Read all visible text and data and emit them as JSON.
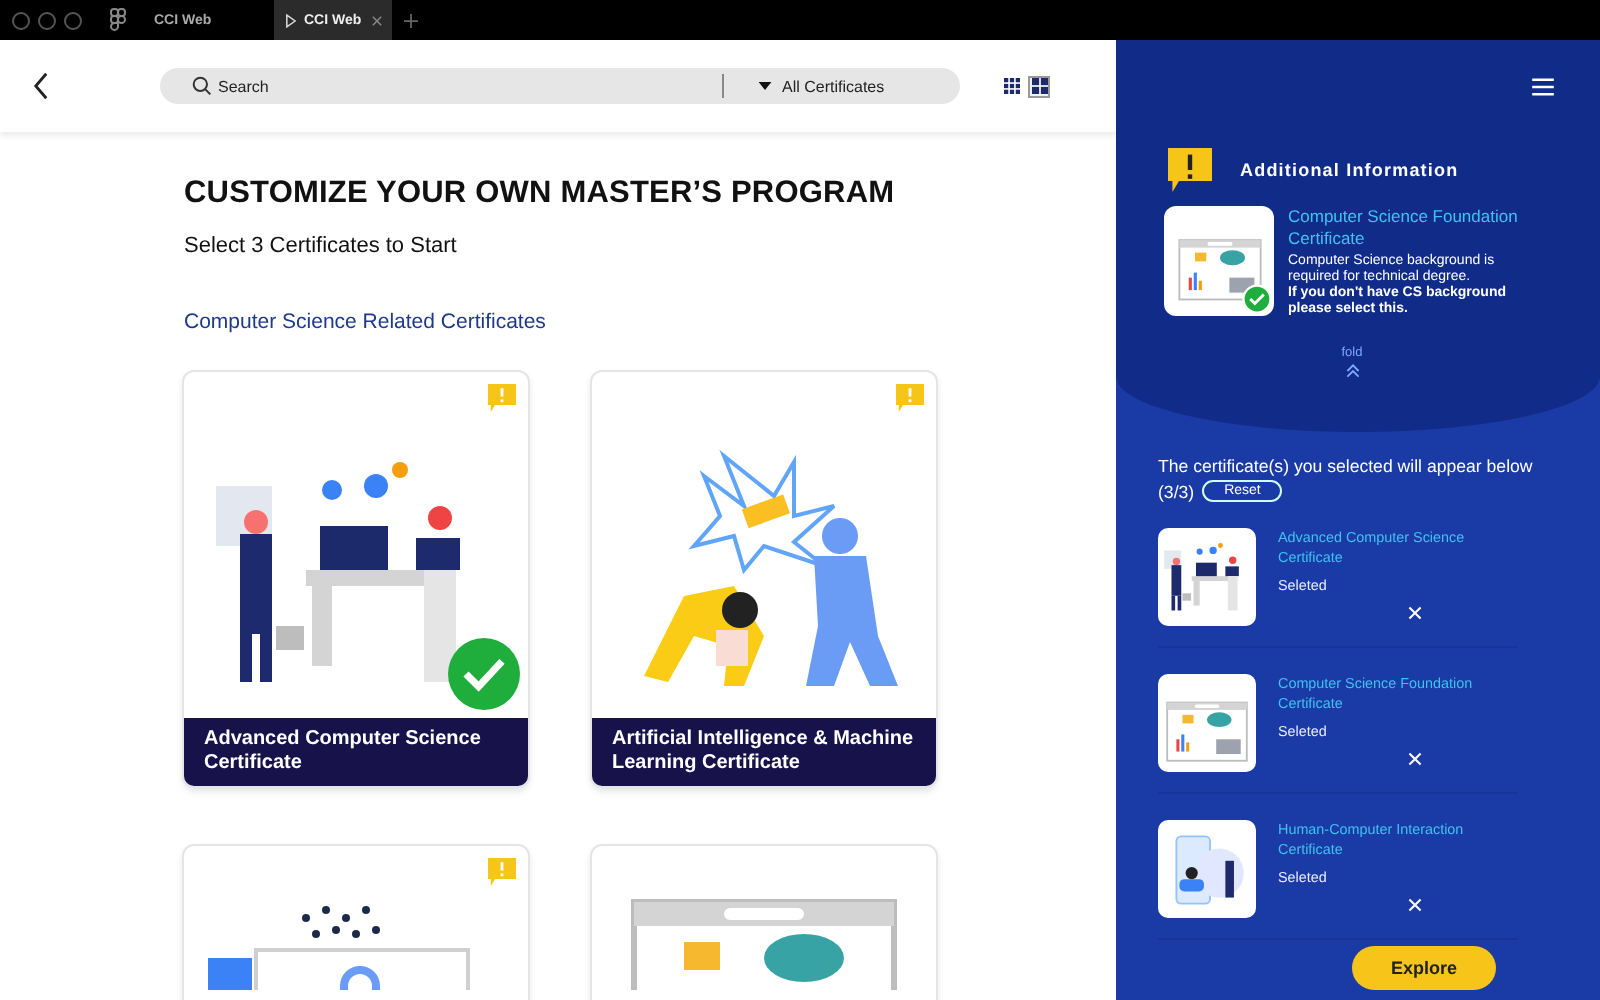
{
  "browser": {
    "tabs": [
      {
        "label": "CCI Web",
        "selected": false,
        "play": false
      },
      {
        "label": "CCI Web",
        "selected": true,
        "play": true
      }
    ]
  },
  "header": {
    "search": {
      "placeholder": "Search"
    },
    "filter": {
      "value": "All Certificates"
    },
    "views": [
      {
        "kind": "small-grid",
        "selected": false
      },
      {
        "kind": "large-grid",
        "selected": true
      }
    ]
  },
  "page": {
    "title": "CUSTOMIZE YOUR OWN MASTER’S PROGRAM",
    "subtitle": "Select 3 Certificates to Start",
    "section": "Computer Science Related Certificates",
    "cards": [
      {
        "kind": "people-laptop",
        "title": "Advanced Computer Science Certificate",
        "info": true,
        "selected": true
      },
      {
        "kind": "ai-robot",
        "title": "Artificial Intelligence & Machine Learning Certificate",
        "info": true,
        "selected": false
      },
      {
        "kind": "security-lock",
        "info": true
      },
      {
        "kind": "browser-cloud",
        "info": false
      }
    ]
  },
  "panel": {
    "info": {
      "heading": "Additional Information",
      "kind": "browser-cloud",
      "title": "Computer Science Foundation Certificate",
      "description": "Computer Science background is required for technical degree.",
      "note": "If you don't have CS background please select this.",
      "fold": "fold"
    },
    "selected_text": "The certificate(s) you selected will appear below",
    "count": "(3/3)",
    "reset": "Reset",
    "items": [
      {
        "kind": "people-laptop",
        "title": "Advanced Computer Science Certificate",
        "status": "Seleted"
      },
      {
        "kind": "browser-cloud",
        "title": "Computer Science Foundation Certificate",
        "status": "Seleted"
      },
      {
        "kind": "human-computer",
        "title": "Human-Computer Interaction Certificate",
        "status": "Seleted"
      }
    ],
    "explore": "Explore"
  }
}
